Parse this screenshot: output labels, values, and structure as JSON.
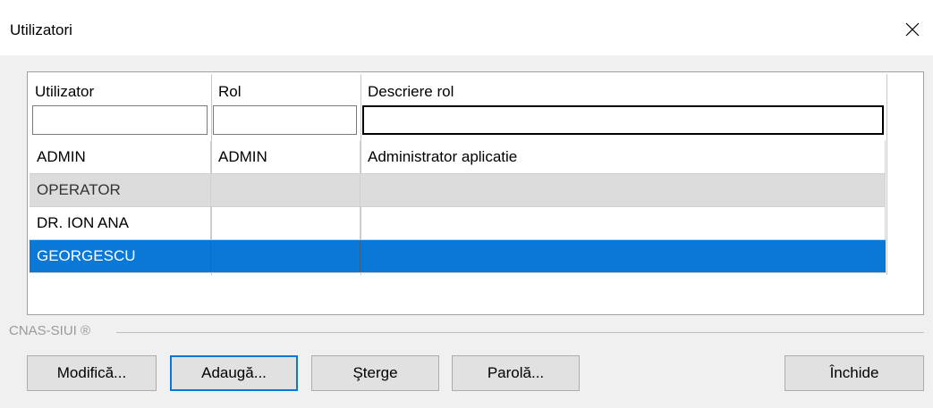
{
  "window": {
    "title": "Utilizatori"
  },
  "table": {
    "columns": [
      "Utilizator",
      "Rol",
      "Descriere rol"
    ],
    "filters": [
      "",
      "",
      ""
    ],
    "rows": [
      {
        "user": "ADMIN",
        "role": "ADMIN",
        "description": "Administrator aplicatie",
        "state": "normal"
      },
      {
        "user": "OPERATOR",
        "role": "",
        "description": "",
        "state": "alternate"
      },
      {
        "user": "DR. ION ANA",
        "role": "",
        "description": "",
        "state": "normal"
      },
      {
        "user": "GEORGESCU",
        "role": "",
        "description": "",
        "state": "selected"
      }
    ]
  },
  "group_label": "CNAS-SIUI ®",
  "buttons": {
    "modify": "Modifică...",
    "add": "Adaugă...",
    "delete": "Şterge",
    "password": "Parolă...",
    "close": "Închide"
  },
  "colors": {
    "selection": "#0a78d7",
    "alternate_row": "#dcdcdc"
  }
}
